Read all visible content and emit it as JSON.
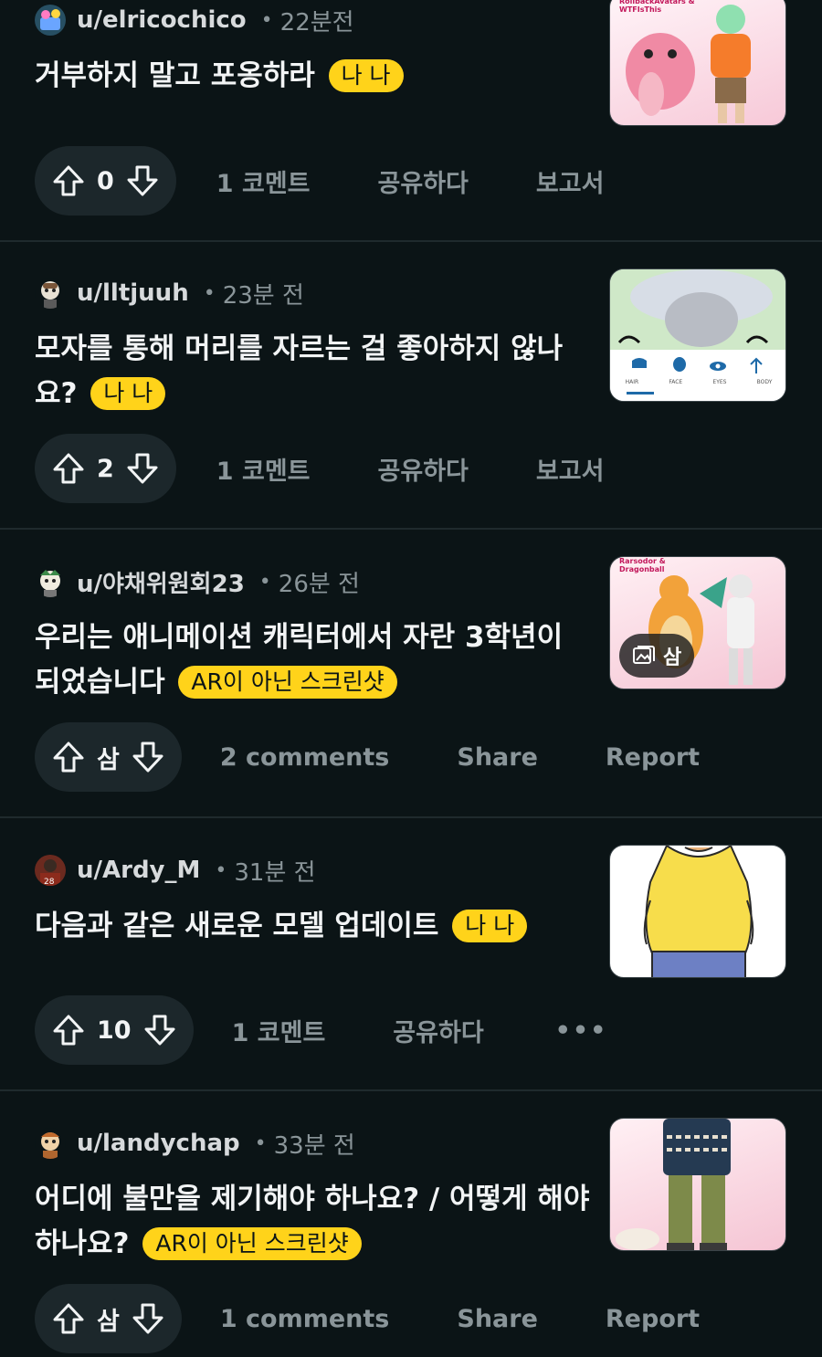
{
  "posts": [
    {
      "username": "u/elricochico",
      "time": "22분전",
      "title": "거부하지 말고 포옹하라",
      "flair": "나 나",
      "score": "0",
      "comments": "1 코멘트",
      "share": "공유하다",
      "report": "보고서",
      "thumb_caption": "RollbackAvatars & WTFIsThis"
    },
    {
      "username": "u/lltjuuh",
      "time": "23분 전",
      "title": "모자를 통해 머리를 자르는 걸 좋아하지 않나요?",
      "flair": "나 나",
      "score": "2",
      "comments": "1 코멘트",
      "share": "공유하다",
      "report": "보고서",
      "thumb_tabs": [
        "HAIR",
        "FACE",
        "EYES",
        "BODY"
      ]
    },
    {
      "username": "u/야채위원회23",
      "time": "26분 전",
      "title": "우리는 애니메이션 캐릭터에서 자란 3학년이 되었습니다",
      "flair": "AR이 아닌 스크린샷",
      "score": "삼",
      "comments": "2 comments",
      "share": "Share",
      "report": "Report",
      "thumb_caption": "Rarsodor & Dragonball",
      "gallery_count": "삼"
    },
    {
      "username": "u/Ardy_M",
      "time": "31분 전",
      "title": "다음과 같은 새로운 모델 업데이트",
      "flair": "나 나",
      "score": "10",
      "comments": "1 코멘트",
      "share": "공유하다",
      "more": "•••"
    },
    {
      "username": "u/landychap",
      "time": "33분 전",
      "title": "어디에 불만을 제기해야 하나요? / 어떻게 해야 하나요?",
      "flair": "AR이 아닌 스크린샷",
      "score": "삼",
      "comments": "1 comments",
      "share": "Share",
      "report": "Report"
    }
  ],
  "colors": {
    "background": "#0b1416",
    "flair": "#ffd31a",
    "vote_pill": "#1c272b",
    "muted_text": "#8a9599"
  }
}
